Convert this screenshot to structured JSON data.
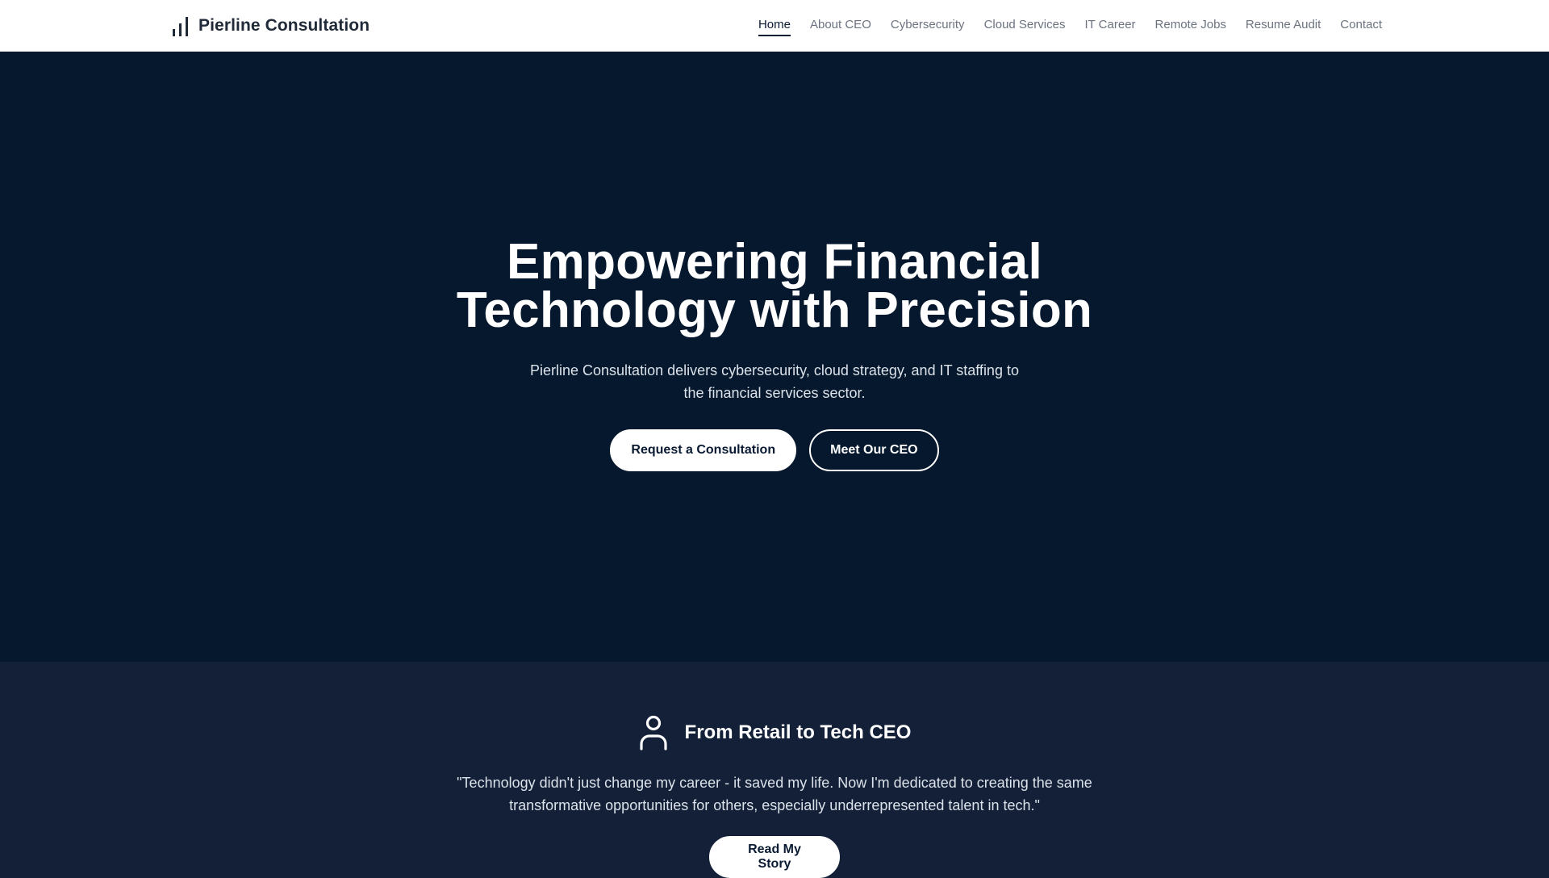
{
  "header": {
    "brand_name": "Pierline Consultation",
    "brand_icon": "bar-chart-icon",
    "nav": [
      {
        "label": "Home",
        "active": true
      },
      {
        "label": "About CEO"
      },
      {
        "label": "Cybersecurity"
      },
      {
        "label": "Cloud Services"
      },
      {
        "label": "IT Career"
      },
      {
        "label": "Remote Jobs"
      },
      {
        "label": "Resume Audit"
      },
      {
        "label": "Contact"
      }
    ]
  },
  "hero": {
    "title_line1": "Empowering Financial",
    "title_line2": "Technology with Precision",
    "subtitle_line1": "Pierline Consultation delivers cybersecurity, cloud strategy, and IT staffing to",
    "subtitle_line2": "the financial services sector.",
    "primary_button": "Request a Consultation",
    "secondary_button": "Meet Our CEO"
  },
  "story": {
    "icon": "user-icon",
    "title": "From Retail to Tech CEO",
    "quote_line1": "\"Technology didn't just change my career - it saved my life. Now I'm dedicated to creating the same",
    "quote_line2": "transformative opportunities for others, especially underrepresented talent in tech.\"",
    "button": "Read My Story"
  },
  "colors": {
    "hero_bg": "#06182d",
    "story_bg": "#132038",
    "navbar_bg": "#ffffff",
    "accent": "#0a1a33"
  }
}
